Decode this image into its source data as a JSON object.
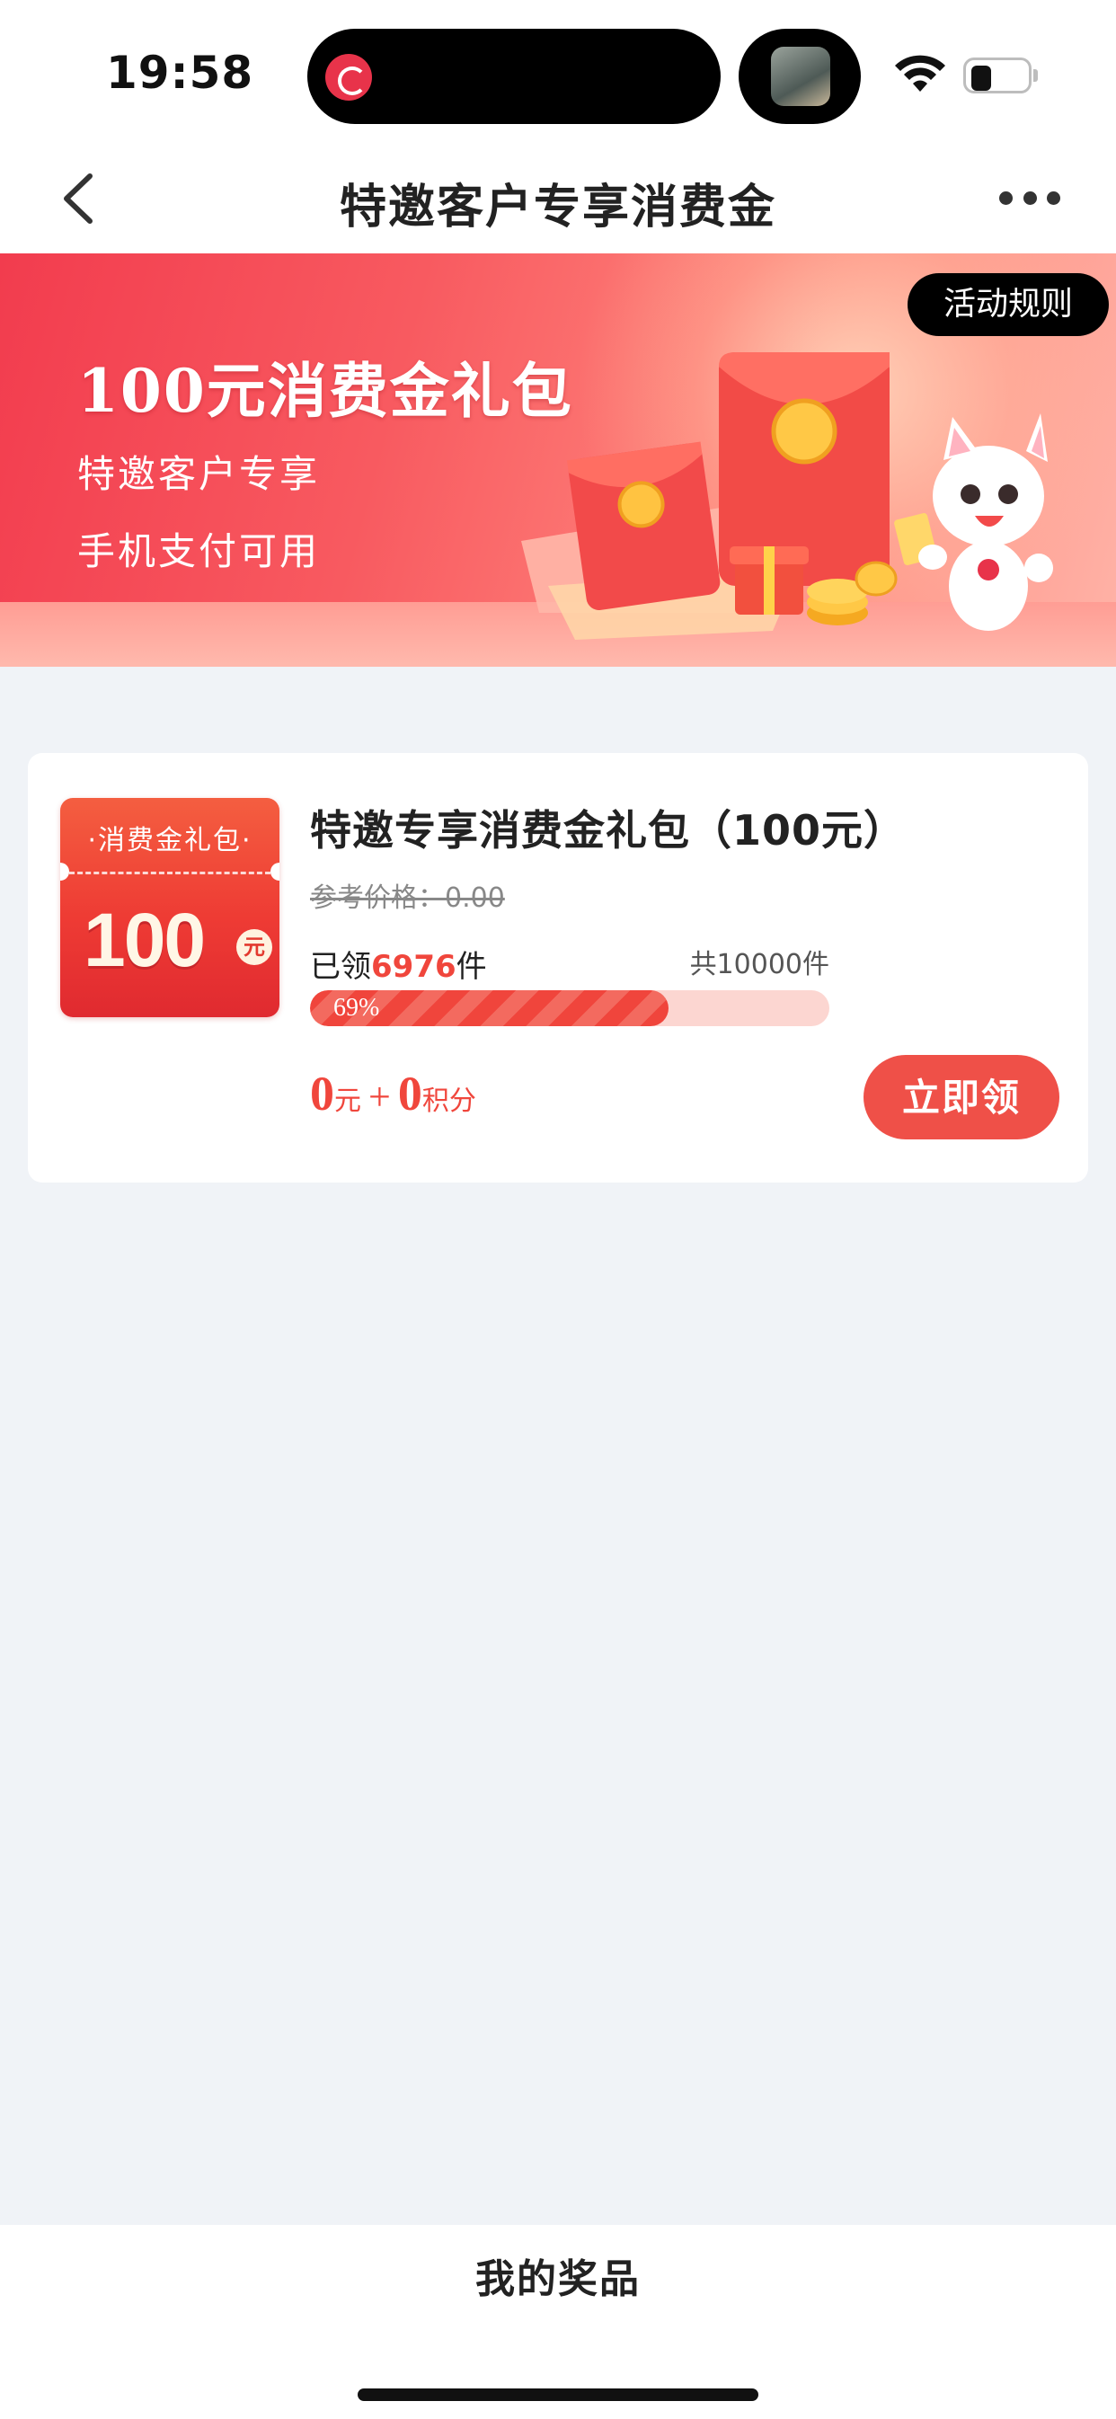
{
  "status_bar": {
    "time": "19:58",
    "battery_level": 0.35
  },
  "nav": {
    "title": "特邀客户专享消费金",
    "back_icon": "chevron-left-icon",
    "more_icon": "more-dots-icon"
  },
  "banner": {
    "rules_button": "活动规则",
    "title": "100元消费金礼包",
    "subtitle_1": "特邀客户专享",
    "subtitle_2": "手机支付可用"
  },
  "prize": {
    "image_label": "·消费金礼包·",
    "image_amount": "100",
    "image_unit": "元",
    "name": "特邀专享消费金礼包（100元）",
    "ref_price": "参考价格：0.00",
    "claimed_prefix": "已领",
    "claimed_count": "6976",
    "claimed_suffix": "件",
    "total": "共10000件",
    "progress_percent": 69,
    "progress_text": "69%",
    "price_cash": "0",
    "price_cash_unit": "元",
    "price_plus": "+",
    "price_points": "0",
    "price_points_unit": "积分",
    "claim_button": "立即领"
  },
  "bottom": {
    "my_prizes": "我的奖品"
  },
  "colors": {
    "accent": "#f0463c",
    "banner": "#f23c4e",
    "page_bg": "#f0f3f7"
  }
}
